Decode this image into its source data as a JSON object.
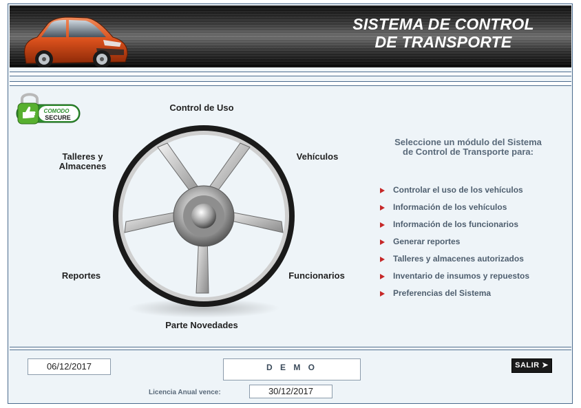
{
  "header": {
    "title_line1": "SISTEMA DE CONTROL",
    "title_line2": "DE TRANSPORTE",
    "car_icon": "car-icon"
  },
  "seal": {
    "brand": "COMODO",
    "label": "SECURE",
    "icon": "padlock-thumbs-up-icon"
  },
  "wheel": {
    "icon": "steering-wheel-icon",
    "labels": {
      "top": "Control de Uso",
      "top_right": "Vehículos",
      "top_left_1": "Talleres y",
      "top_left_2": "Almacenes",
      "bottom_left": "Reportes",
      "bottom_right": "Funcionarios",
      "bottom": "Parte Novedades"
    }
  },
  "intro": {
    "line1": "Seleccione un módulo del Sistema",
    "line2": "de Control de Transporte para:"
  },
  "menu": {
    "arrow_color": "#c62828",
    "items": [
      {
        "label": "Controlar el uso de los vehículos"
      },
      {
        "label": "Información de los vehículos"
      },
      {
        "label": "Información de los funcionarios"
      },
      {
        "label": "Generar reportes"
      },
      {
        "label": "Talleres y almacenes autorizados"
      },
      {
        "label": "Inventario de insumos y repuestos"
      },
      {
        "label": "Preferencias del Sistema"
      }
    ]
  },
  "footer": {
    "current_date": "06/12/2017",
    "mode": "D E M O",
    "license_label": "Licencia Anual vence:",
    "license_date": "30/12/2017",
    "exit_label": "SALIR ➤"
  }
}
